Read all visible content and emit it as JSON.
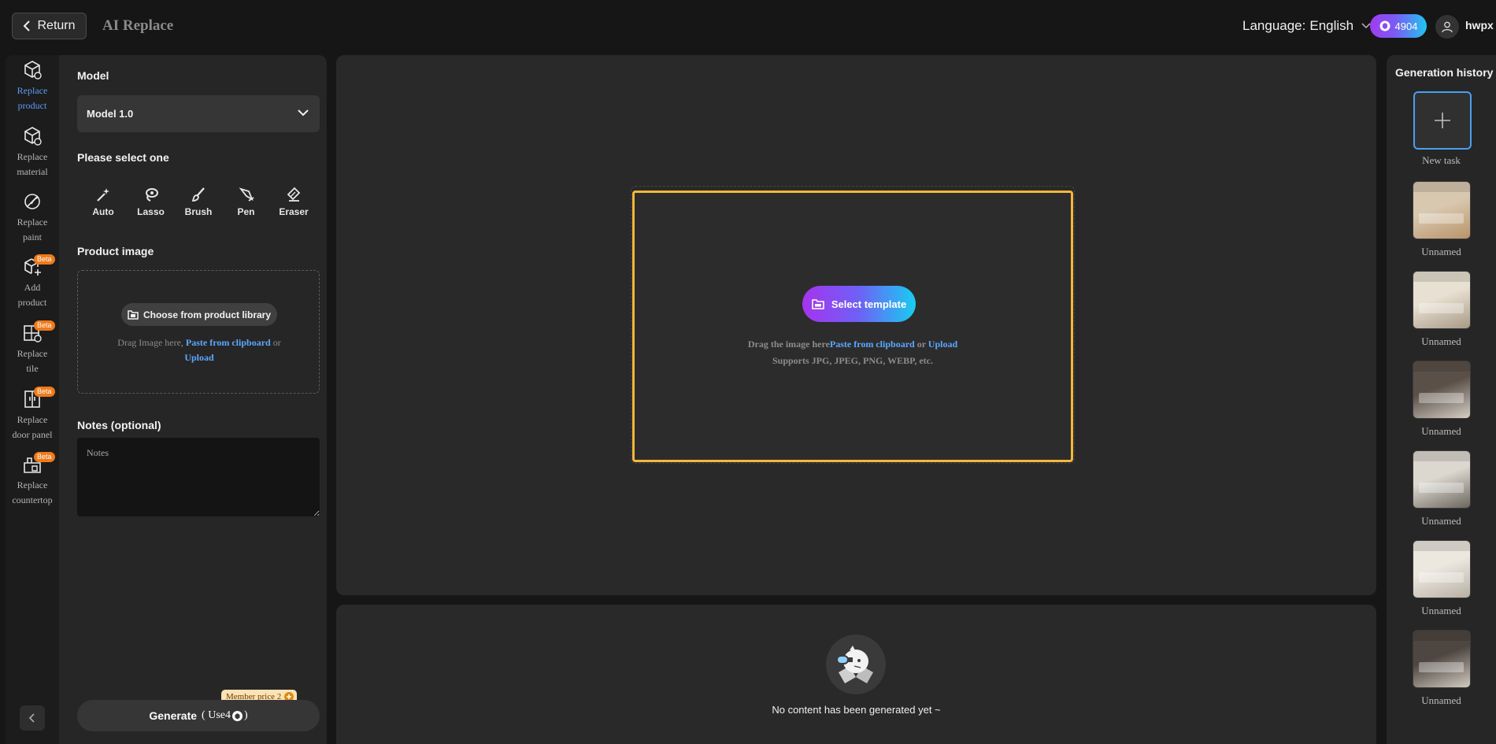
{
  "header": {
    "return_label": "Return",
    "title": "AI Replace",
    "language_label": "Language:",
    "language_value": "English",
    "credits": "4904",
    "username": "hwpx"
  },
  "nav": {
    "items": [
      {
        "label_l1": "Replace",
        "label_l2": "product",
        "icon": "cube-replace-icon",
        "active": true
      },
      {
        "label_l1": "Replace",
        "label_l2": "material",
        "icon": "cube-material-icon"
      },
      {
        "label_l1": "Replace",
        "label_l2": "paint",
        "icon": "paint-icon"
      },
      {
        "label_l1": "Add",
        "label_l2": "product",
        "icon": "add-cube-icon",
        "badge": "Beta"
      },
      {
        "label_l1": "Replace",
        "label_l2": "tile",
        "icon": "tile-icon",
        "badge": "Beta"
      },
      {
        "label_l1": "Replace",
        "label_l2": "door panel",
        "icon": "door-icon",
        "badge": "Beta"
      },
      {
        "label_l1": "Replace",
        "label_l2": "countertop",
        "icon": "countertop-icon",
        "badge": "Beta"
      }
    ]
  },
  "form": {
    "model_label": "Model",
    "model_value": "Model 1.0",
    "select_label": "Please select one",
    "tools": [
      "Auto",
      "Lasso",
      "Brush",
      "Pen",
      "Eraser"
    ],
    "product_image_label": "Product image",
    "library_button": "Choose from product library",
    "drag_text": "Drag Image here,",
    "paste_link": "Paste from clipboard",
    "or_text": "or",
    "upload_link": "Upload",
    "notes_label": "Notes (optional)",
    "notes_placeholder": "Notes",
    "member_price": "Member price 2",
    "generate_label": "Generate",
    "use_prefix": "( Use4",
    "use_suffix": ")"
  },
  "canvas": {
    "select_template": "Select template",
    "drag_text": "Drag the image here",
    "paste_link": "Paste from clipboard",
    "or_text": "or",
    "upload_link": "Upload",
    "formats": "Supports JPG, JPEG, PNG, WEBP, etc."
  },
  "result": {
    "empty_text": "No content has been generated yet ~"
  },
  "history": {
    "title": "Generation history",
    "new_task_label": "New task",
    "items": [
      {
        "label": "Unnamed",
        "tone": [
          "#d8c8b0",
          "#b89468"
        ]
      },
      {
        "label": "Unnamed",
        "tone": [
          "#e8e0d2",
          "#a89a86"
        ]
      },
      {
        "label": "Unnamed",
        "tone": [
          "#5a5048",
          "#d6cfc4"
        ]
      },
      {
        "label": "Unnamed",
        "tone": [
          "#dcd8d0",
          "#6b665e"
        ]
      },
      {
        "label": "Unnamed",
        "tone": [
          "#ece8e0",
          "#b8b0a4"
        ]
      },
      {
        "label": "Unnamed",
        "tone": [
          "#4e4640",
          "#d2cbc0"
        ]
      }
    ]
  },
  "colors": {
    "accent_blue": "#5b9cf5",
    "frame_yellow": "#f5b73b",
    "beta_orange": "#f07a19",
    "link_blue": "#5ca8ff"
  }
}
